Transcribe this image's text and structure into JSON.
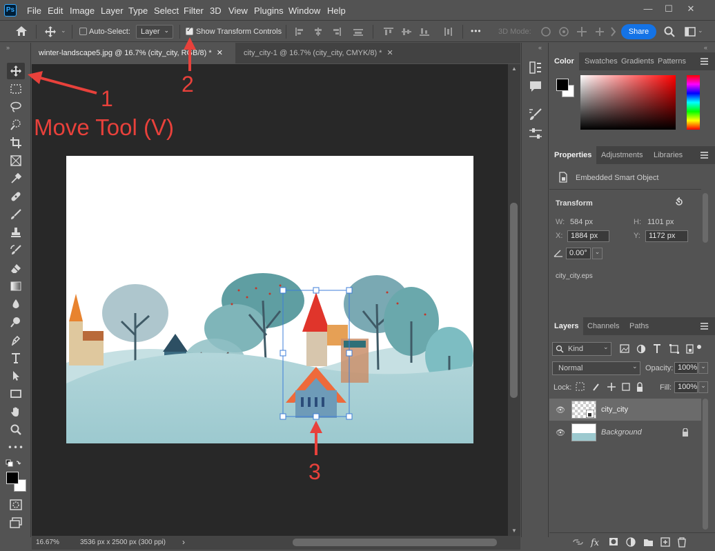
{
  "app": {
    "logo": "Ps"
  },
  "menu": [
    "File",
    "Edit",
    "Image",
    "Layer",
    "Type",
    "Select",
    "Filter",
    "3D",
    "View",
    "Plugins",
    "Window",
    "Help"
  ],
  "window_controls": {
    "minimize": "—",
    "maximize": "☐",
    "close": "✕"
  },
  "options_bar": {
    "auto_select_label": "Auto-Select:",
    "auto_select_value": "Layer",
    "show_transform_label": "Show Transform Controls",
    "more": "•••",
    "mode_3d_label": "3D Mode:",
    "share_label": "Share"
  },
  "tabs": [
    {
      "label": "winter-landscape5.jpg @ 16.7% (city_city, RGB/8) *",
      "close": "✕"
    },
    {
      "label": "city_city-1 @ 16.7% (city_city, CMYK/8) *",
      "close": "✕"
    }
  ],
  "status": {
    "zoom": "16.67%",
    "doc_info": "3536 px x 2500 px (300 ppi)",
    "arrow": "›"
  },
  "color_panel": {
    "tabs": [
      "Color",
      "Swatches",
      "Gradients",
      "Patterns"
    ]
  },
  "properties_panel": {
    "tabs": [
      "Properties",
      "Adjustments",
      "Libraries"
    ],
    "type_label": "Embedded Smart Object",
    "transform_title": "Transform",
    "w_label": "W:",
    "w_value": "584 px",
    "h_label": "H:",
    "h_value": "1101 px",
    "x_label": "X:",
    "x_value": "1884 px",
    "y_label": "Y:",
    "y_value": "1172 px",
    "angle_value": "0.00°",
    "filename": "city_city.eps"
  },
  "layers_panel": {
    "tabs": [
      "Layers",
      "Channels",
      "Paths"
    ],
    "kind_label": "Kind",
    "blend_mode": "Normal",
    "opacity_label": "Opacity:",
    "opacity_value": "100%",
    "lock_label": "Lock:",
    "fill_label": "Fill:",
    "fill_value": "100%",
    "layers": [
      {
        "name": "city_city",
        "selected": true
      },
      {
        "name": "Background",
        "locked": true
      }
    ],
    "footer_icons": [
      "link-icon",
      "fx-icon",
      "mask-icon",
      "adjustment-icon",
      "group-icon",
      "new-layer-icon",
      "trash-icon"
    ]
  },
  "annotations": {
    "n1": "1",
    "n2": "2",
    "n3": "3",
    "move_tool": "Move Tool (V)"
  },
  "colors": {
    "accent": "#1473e6",
    "annotation": "#e8413b",
    "selection": "#3d7dd8"
  }
}
